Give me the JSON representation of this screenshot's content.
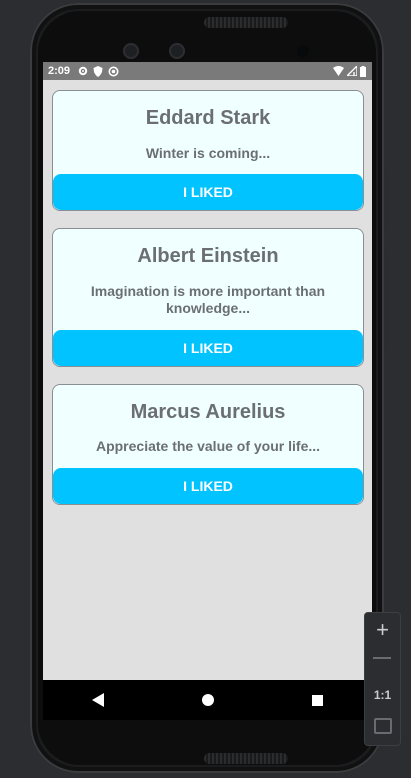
{
  "status": {
    "time": "2:09",
    "left_icons": [
      "gear-icon",
      "shield-icon",
      "circle-icon"
    ],
    "right_icons": [
      "wifi-icon",
      "signal-icon",
      "battery-icon"
    ]
  },
  "cards": [
    {
      "name": "Eddard Stark",
      "quote": "Winter is coming...",
      "button": "I LIKED"
    },
    {
      "name": "Albert Einstein",
      "quote": "Imagination is more important than knowledge...",
      "button": "I LIKED"
    },
    {
      "name": "Marcus Aurelius",
      "quote": "Appreciate the value of your life...",
      "button": "I LIKED"
    }
  ],
  "navbar": {
    "icons": [
      "back-icon",
      "home-icon",
      "recents-icon"
    ]
  },
  "zoom_panel": {
    "zoom_in": "+",
    "ratio": "1:1"
  },
  "colors": {
    "accent": "#00c3ff",
    "card_background": "#f0ffff",
    "text": "#6b6f72",
    "screen_background": "#e0e0e0"
  }
}
